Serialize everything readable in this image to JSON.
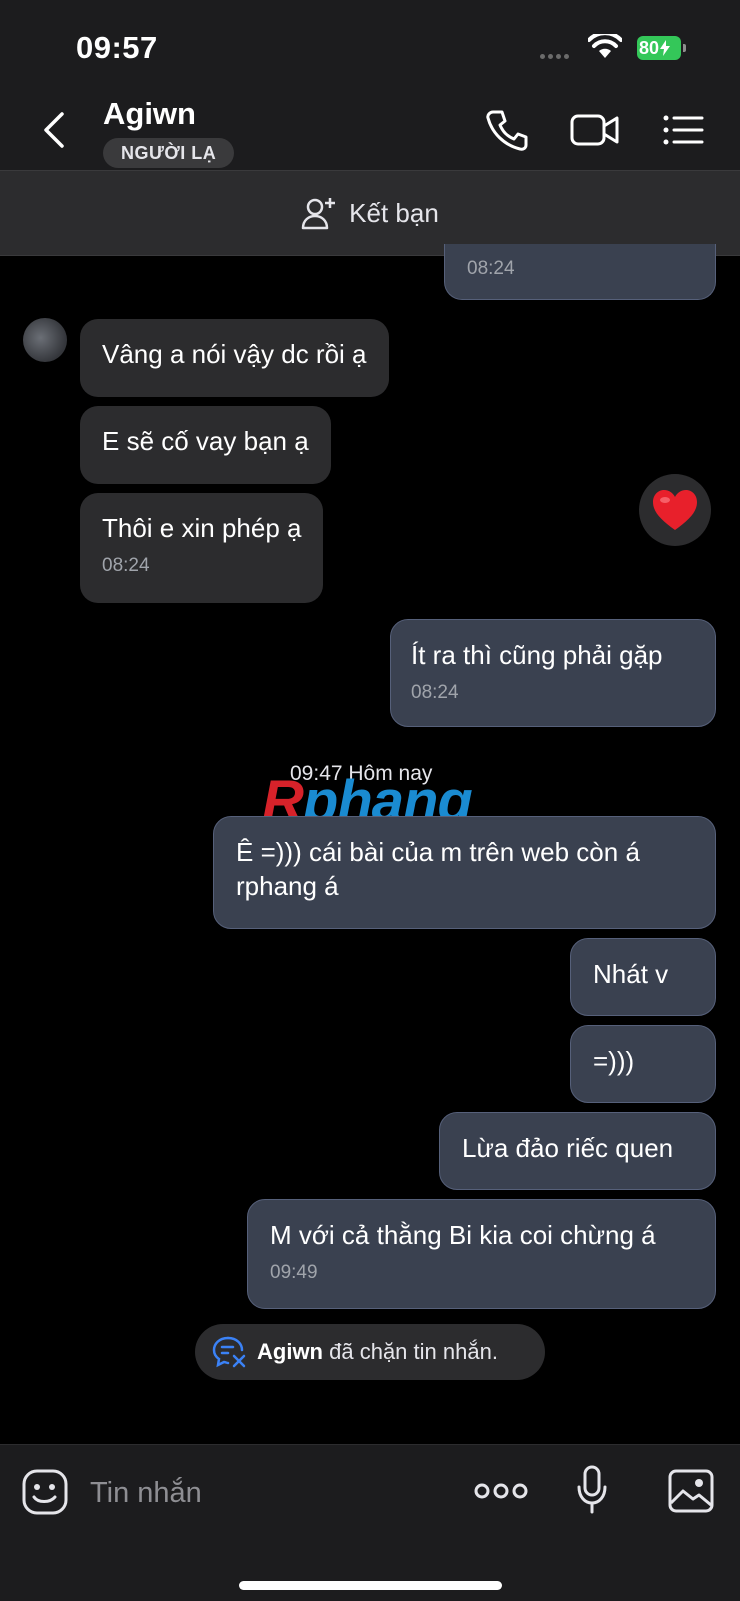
{
  "status_bar": {
    "time": "09:57",
    "battery": "80"
  },
  "header": {
    "title": "Agiwn",
    "badge": "NGƯỜI LẠ"
  },
  "add_friend": {
    "label": "Kết bạn"
  },
  "messages": [
    {
      "text": "",
      "time": "08:24"
    },
    {
      "text": "Vâng a nói vậy dc rồi ạ"
    },
    {
      "text": "E sẽ cố vay bạn ạ"
    },
    {
      "text": "Thôi e xin phép ạ",
      "time": "08:24"
    },
    {
      "text": "Ít ra thì cũng phải gặp",
      "time": "08:24"
    },
    {
      "text": "Ê =))) cái bài của m trên web còn á rphang á"
    },
    {
      "text": "Nhát v"
    },
    {
      "text": "=)))"
    },
    {
      "text": "Lừa đảo riếc quen"
    },
    {
      "text": "M với cả thằng Bi kia coi chừng á",
      "time": "09:49"
    }
  ],
  "divider": {
    "time": "09:47 Hôm nay"
  },
  "watermark": {
    "part1": "R",
    "part2": "phang"
  },
  "blocked_notice": {
    "name": "Agiwn",
    "text": "đã chặn tin nhắn."
  },
  "composer": {
    "placeholder": "Tin nhắn"
  }
}
